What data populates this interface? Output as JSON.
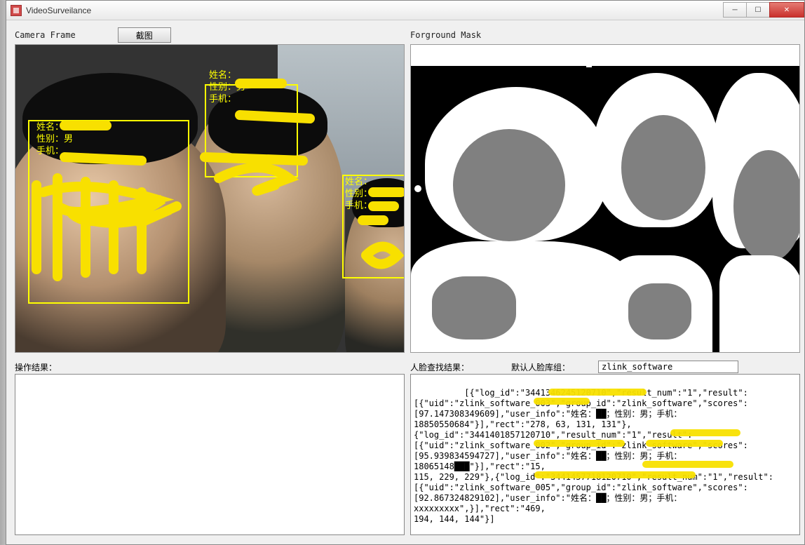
{
  "window": {
    "title": "VideoSurveilance"
  },
  "panes": {
    "camera_label": "Camera Frame",
    "mask_label": "Forground Mask",
    "screenshot_btn": "截图"
  },
  "faces": [
    {
      "name_label": "姓名：",
      "gender_label": "性别：男",
      "phone_label": "手机："
    },
    {
      "name_label": "姓名：",
      "gender_label": "性别：男",
      "phone_label": "手机："
    },
    {
      "name_label": "姓名：",
      "gender_label": "性别：男",
      "phone_label": "手机："
    }
  ],
  "bottom": {
    "op_result_label": "操作结果：",
    "face_search_label": "人脸查找结果：",
    "default_group_label": "默认人脸库组：",
    "default_group_value": "zlink_software"
  },
  "search_result_text": "[{\"log_id\":\"3441346245120710\",\"result_num\":\"1\",\"result\":\n[{\"uid\":\"zlink_software_003\",\"group_id\":\"zlink_software\",\"scores\":\n[97.147308349609],\"user_info\":\"姓名：██；性别：男；手机：\n18850550684\"}],\"rect\":\"278, 63, 131, 131\"},\n{\"log_id\":\"3441401857120710\",\"result_num\":\"1\",\"result\":\n[{\"uid\":\"zlink_software_002\",\"group_id\":\"zlink_software\",\"scores\":\n[95.939834594727],\"user_info\":\"姓名：██；性别：男；手机：18065148███\"}],\"rect\":\"15,\n115, 229, 229\"},{\"log_id\":\"3441457718120710\",\"result_num\":\"1\",\"result\":\n[{\"uid\":\"zlink_software_005\",\"group_id\":\"zlink_software\",\"scores\":\n[92.867324829102],\"user_info\":\"姓名：██；性别：男；手机：xxxxxxxxx\",}],\"rect\":\"469,\n194, 144, 144\"}]"
}
